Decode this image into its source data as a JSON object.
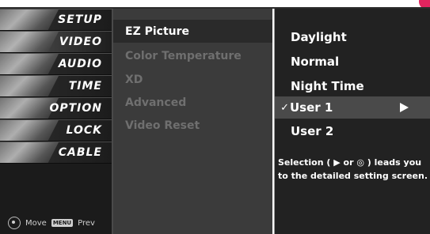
{
  "main_menu": {
    "items": [
      {
        "label": "SETUP",
        "icon": "setup-thumbnail"
      },
      {
        "label": "VIDEO",
        "icon": "video-thumbnail"
      },
      {
        "label": "AUDIO",
        "icon": "audio-thumbnail"
      },
      {
        "label": "TIME",
        "icon": "time-thumbnail"
      },
      {
        "label": "OPTION",
        "icon": "option-thumbnail"
      },
      {
        "label": "LOCK",
        "icon": "lock-thumbnail"
      },
      {
        "label": "CABLE",
        "icon": "cable-thumbnail"
      }
    ],
    "active_index": 1,
    "footer": {
      "move_label": "Move",
      "menu_key_label": "MENU",
      "prev_label": "Prev"
    }
  },
  "video_menu": {
    "items": [
      {
        "label": "EZ Picture",
        "active": true
      },
      {
        "label": "Color Temperature",
        "active": false
      },
      {
        "label": "XD",
        "active": false
      },
      {
        "label": "Advanced",
        "active": false
      },
      {
        "label": "Video Reset",
        "active": false
      }
    ]
  },
  "ez_picture_popup": {
    "options": [
      {
        "label": "Daylight"
      },
      {
        "label": "Normal"
      },
      {
        "label": "Night Time"
      },
      {
        "label": "User 1",
        "checkmark": "✓",
        "selected": true
      },
      {
        "label": "User 2"
      }
    ],
    "help_text": "Selection ( ▶ or ◎ ) leads you to the detailed setting screen."
  },
  "colors": {
    "background_menu": "#1b1b1b",
    "submenu_bg": "#3b3b3b",
    "popup_bg": "#222222",
    "selected_row": "#4a4a4a",
    "accent_dot": "#e0245e"
  }
}
